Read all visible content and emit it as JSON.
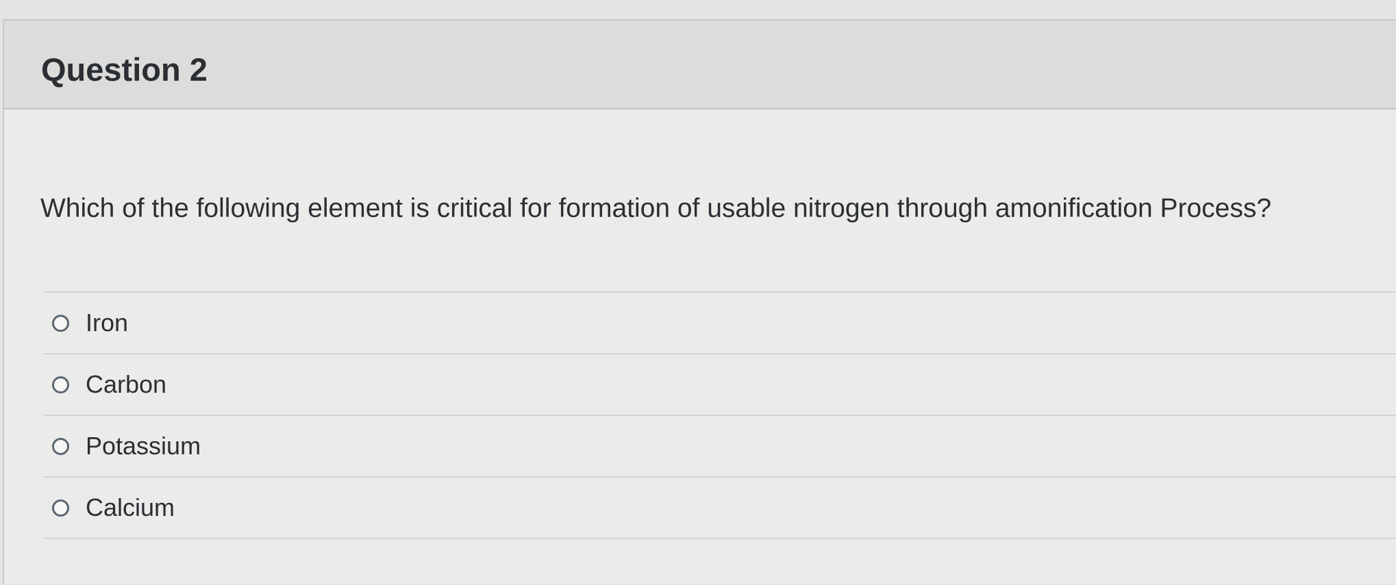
{
  "question": {
    "title": "Question 2",
    "text": "Which of the following element is critical for formation of usable nitrogen through amonification Process?"
  },
  "answers": [
    {
      "label": "Iron",
      "selected": false
    },
    {
      "label": "Carbon",
      "selected": false
    },
    {
      "label": "Potassium",
      "selected": false
    },
    {
      "label": "Calcium",
      "selected": false
    }
  ]
}
